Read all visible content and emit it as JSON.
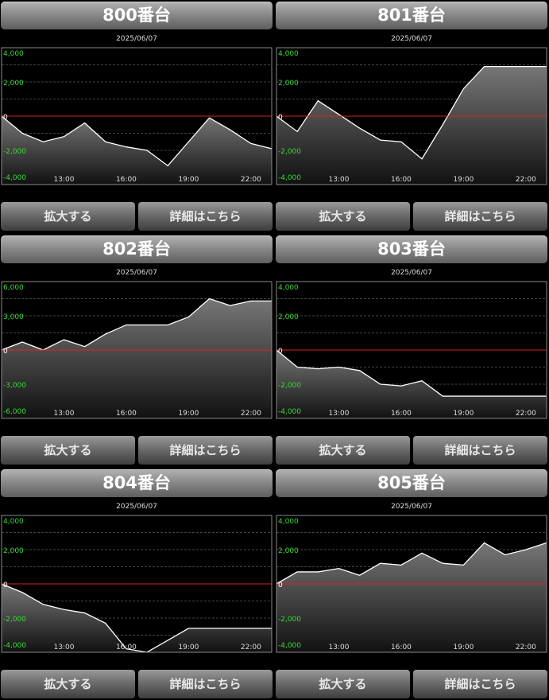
{
  "buttons": {
    "zoom": "拡大する",
    "detail": "詳細はこちら"
  },
  "colors": {
    "ytick": "#33dd33",
    "zero_line": "#e02020",
    "series_line": "#ffffff",
    "axis_border": "#8a8a8a",
    "grid": "#444444"
  },
  "panels": [
    {
      "title": "800番台",
      "chart_data": {
        "type": "area",
        "date": "2025/06/07",
        "xticks": [
          "13:00",
          "16:00",
          "19:00",
          "22:00"
        ],
        "yticks": [
          "4,000",
          "2,000",
          "0",
          "-2,000",
          "-4,000"
        ],
        "ylim": [
          -4000,
          4000
        ],
        "x": [
          10,
          11,
          12,
          13,
          14,
          15,
          16,
          17,
          18,
          19,
          20,
          21,
          22,
          23
        ],
        "values": [
          0,
          -1000,
          -1500,
          -1200,
          -400,
          -1500,
          -1800,
          -2000,
          -2900,
          -1500,
          -100,
          -800,
          -1600,
          -1900
        ]
      }
    },
    {
      "title": "801番台",
      "chart_data": {
        "type": "area",
        "date": "2025/06/07",
        "xticks": [
          "13:00",
          "16:00",
          "19:00",
          "22:00"
        ],
        "yticks": [
          "4,000",
          "2,000",
          "0",
          "-2,000",
          "-4,000"
        ],
        "ylim": [
          -4000,
          4000
        ],
        "x": [
          10,
          11,
          12,
          13,
          14,
          15,
          16,
          17,
          18,
          19,
          20,
          21,
          22,
          23
        ],
        "values": [
          0,
          -900,
          900,
          100,
          -700,
          -1400,
          -1500,
          -2500,
          -500,
          1600,
          2900,
          2900,
          2900,
          2900
        ]
      }
    },
    {
      "title": "802番台",
      "chart_data": {
        "type": "area",
        "date": "2025/06/07",
        "xticks": [
          "13:00",
          "16:00",
          "19:00",
          "22:00"
        ],
        "yticks": [
          "6,000",
          "3,000",
          "0",
          "-3,000",
          "-6,000"
        ],
        "ylim": [
          -6000,
          6000
        ],
        "x": [
          10,
          11,
          12,
          13,
          14,
          15,
          16,
          17,
          18,
          19,
          20,
          21,
          22,
          23
        ],
        "values": [
          0,
          700,
          0,
          900,
          300,
          1400,
          2200,
          2200,
          2200,
          2900,
          4500,
          3900,
          4300,
          4300
        ]
      }
    },
    {
      "title": "803番台",
      "chart_data": {
        "type": "area",
        "date": "2025/06/07",
        "xticks": [
          "13:00",
          "16:00",
          "19:00",
          "22:00"
        ],
        "yticks": [
          "4,000",
          "2,000",
          "0",
          "-2,000",
          "-4,000"
        ],
        "ylim": [
          -4000,
          4000
        ],
        "x": [
          10,
          11,
          12,
          13,
          14,
          15,
          16,
          17,
          18,
          19,
          20,
          21,
          22,
          23
        ],
        "values": [
          0,
          -1000,
          -1100,
          -1000,
          -1200,
          -2000,
          -2100,
          -1800,
          -2700,
          -2700,
          -2700,
          -2700,
          -2700,
          -2700
        ]
      }
    },
    {
      "title": "804番台",
      "chart_data": {
        "type": "area",
        "date": "2025/06/07",
        "xticks": [
          "13:00",
          "16:00",
          "19:00",
          "22:00"
        ],
        "yticks": [
          "4,000",
          "2,000",
          "0",
          "-2,000",
          "-4,000"
        ],
        "ylim": [
          -4000,
          4000
        ],
        "x": [
          10,
          11,
          12,
          13,
          14,
          15,
          16,
          17,
          18,
          19,
          20,
          21,
          22,
          23
        ],
        "values": [
          0,
          -500,
          -1200,
          -1500,
          -1700,
          -2300,
          -3800,
          -4000,
          -3300,
          -2600,
          -2600,
          -2600,
          -2600,
          -2600
        ]
      }
    },
    {
      "title": "805番台",
      "chart_data": {
        "type": "area",
        "date": "2025/06/07",
        "xticks": [
          "13:00",
          "16:00",
          "19:00",
          "22:00"
        ],
        "yticks": [
          "4,000",
          "2,000",
          "0",
          "-2,000",
          "-4,000"
        ],
        "ylim": [
          -4000,
          4000
        ],
        "x": [
          10,
          11,
          12,
          13,
          14,
          15,
          16,
          17,
          18,
          19,
          20,
          21,
          22,
          23
        ],
        "values": [
          0,
          700,
          700,
          900,
          500,
          1200,
          1100,
          1800,
          1200,
          1100,
          2400,
          1700,
          2000,
          2400
        ]
      }
    }
  ]
}
